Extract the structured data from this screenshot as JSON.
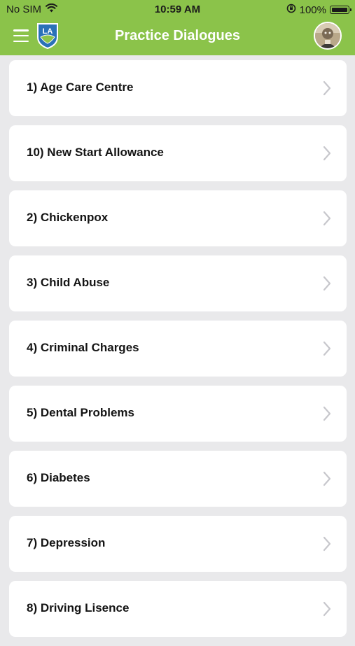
{
  "status_bar": {
    "carrier": "No SIM",
    "time": "10:59 AM",
    "battery_percent": "100%",
    "battery_level": 1.0
  },
  "nav": {
    "title": "Practice Dialogues",
    "logo_text": "LA",
    "menu_icon": "hamburger-menu-icon",
    "avatar_icon": "user-avatar"
  },
  "colors": {
    "header": "#8bc34a",
    "background": "#e9e9eb",
    "card": "#ffffff",
    "chevron": "#c7c7cc"
  },
  "list": {
    "items": [
      {
        "label": "1) Age Care Centre"
      },
      {
        "label": "10) New Start Allowance"
      },
      {
        "label": "2) Chickenpox"
      },
      {
        "label": "3) Child Abuse"
      },
      {
        "label": "4) Criminal Charges"
      },
      {
        "label": "5) Dental Problems"
      },
      {
        "label": "6) Diabetes"
      },
      {
        "label": "7) Depression"
      },
      {
        "label": "8) Driving Lisence"
      }
    ]
  }
}
